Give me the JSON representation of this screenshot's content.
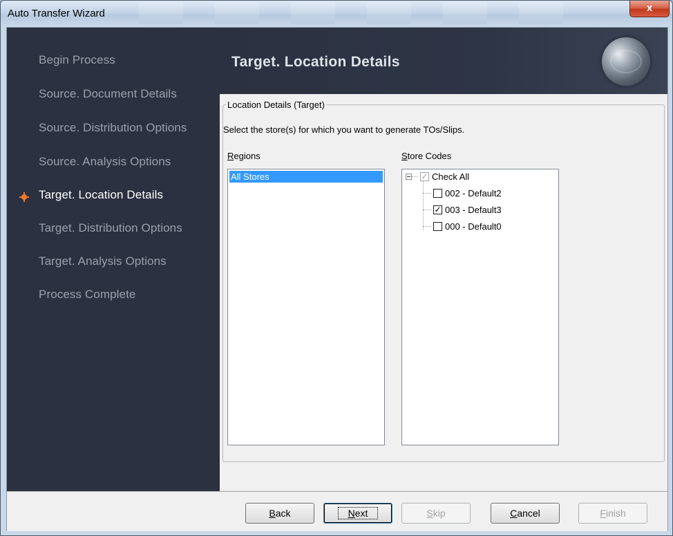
{
  "window": {
    "title": "Auto Transfer Wizard",
    "close_glyph": "x"
  },
  "sidebar": {
    "steps": [
      {
        "label": "Begin Process",
        "active": false
      },
      {
        "label": "Source. Document Details",
        "active": false
      },
      {
        "label": "Source. Distribution Options",
        "active": false
      },
      {
        "label": "Source. Analysis Options",
        "active": false
      },
      {
        "label": "Target. Location Details",
        "active": true
      },
      {
        "label": "Target. Distribution Options",
        "active": false
      },
      {
        "label": "Target. Analysis Options",
        "active": false
      },
      {
        "label": "Process Complete",
        "active": false
      }
    ]
  },
  "header": {
    "title": "Target. Location Details",
    "logo_icon": "globe-icon"
  },
  "group": {
    "legend": "Location Details (Target)",
    "instruction": "Select the store(s) for which you want to generate TOs/Slips."
  },
  "regions": {
    "label_mnemonic": "R",
    "label_rest": "egions",
    "items": [
      "All Stores"
    ],
    "selected": "All Stores"
  },
  "stores": {
    "label_mnemonic": "S",
    "label_rest": "tore Codes",
    "root": {
      "label": "Check All",
      "checked": true,
      "disabled": true,
      "expanded": true
    },
    "items": [
      {
        "label": "002 - Default2",
        "checked": false
      },
      {
        "label": "003 - Default3",
        "checked": true
      },
      {
        "label": "000 - Default0",
        "checked": false
      }
    ]
  },
  "buttons": {
    "back": {
      "mnemonic": "B",
      "rest": "ack",
      "enabled": true
    },
    "next": {
      "mnemonic": "N",
      "rest": "ext",
      "enabled": true,
      "default": true
    },
    "skip": {
      "mnemonic": "S",
      "rest": "kip",
      "enabled": false
    },
    "cancel": {
      "mnemonic": "C",
      "rest": "ancel",
      "enabled": true
    },
    "finish": {
      "mnemonic": "F",
      "rest": "inish",
      "enabled": false
    }
  },
  "colors": {
    "sidebar_bg": "#2b3140",
    "active_step_marker": "#f07a2a",
    "selection": "#3399ff"
  }
}
